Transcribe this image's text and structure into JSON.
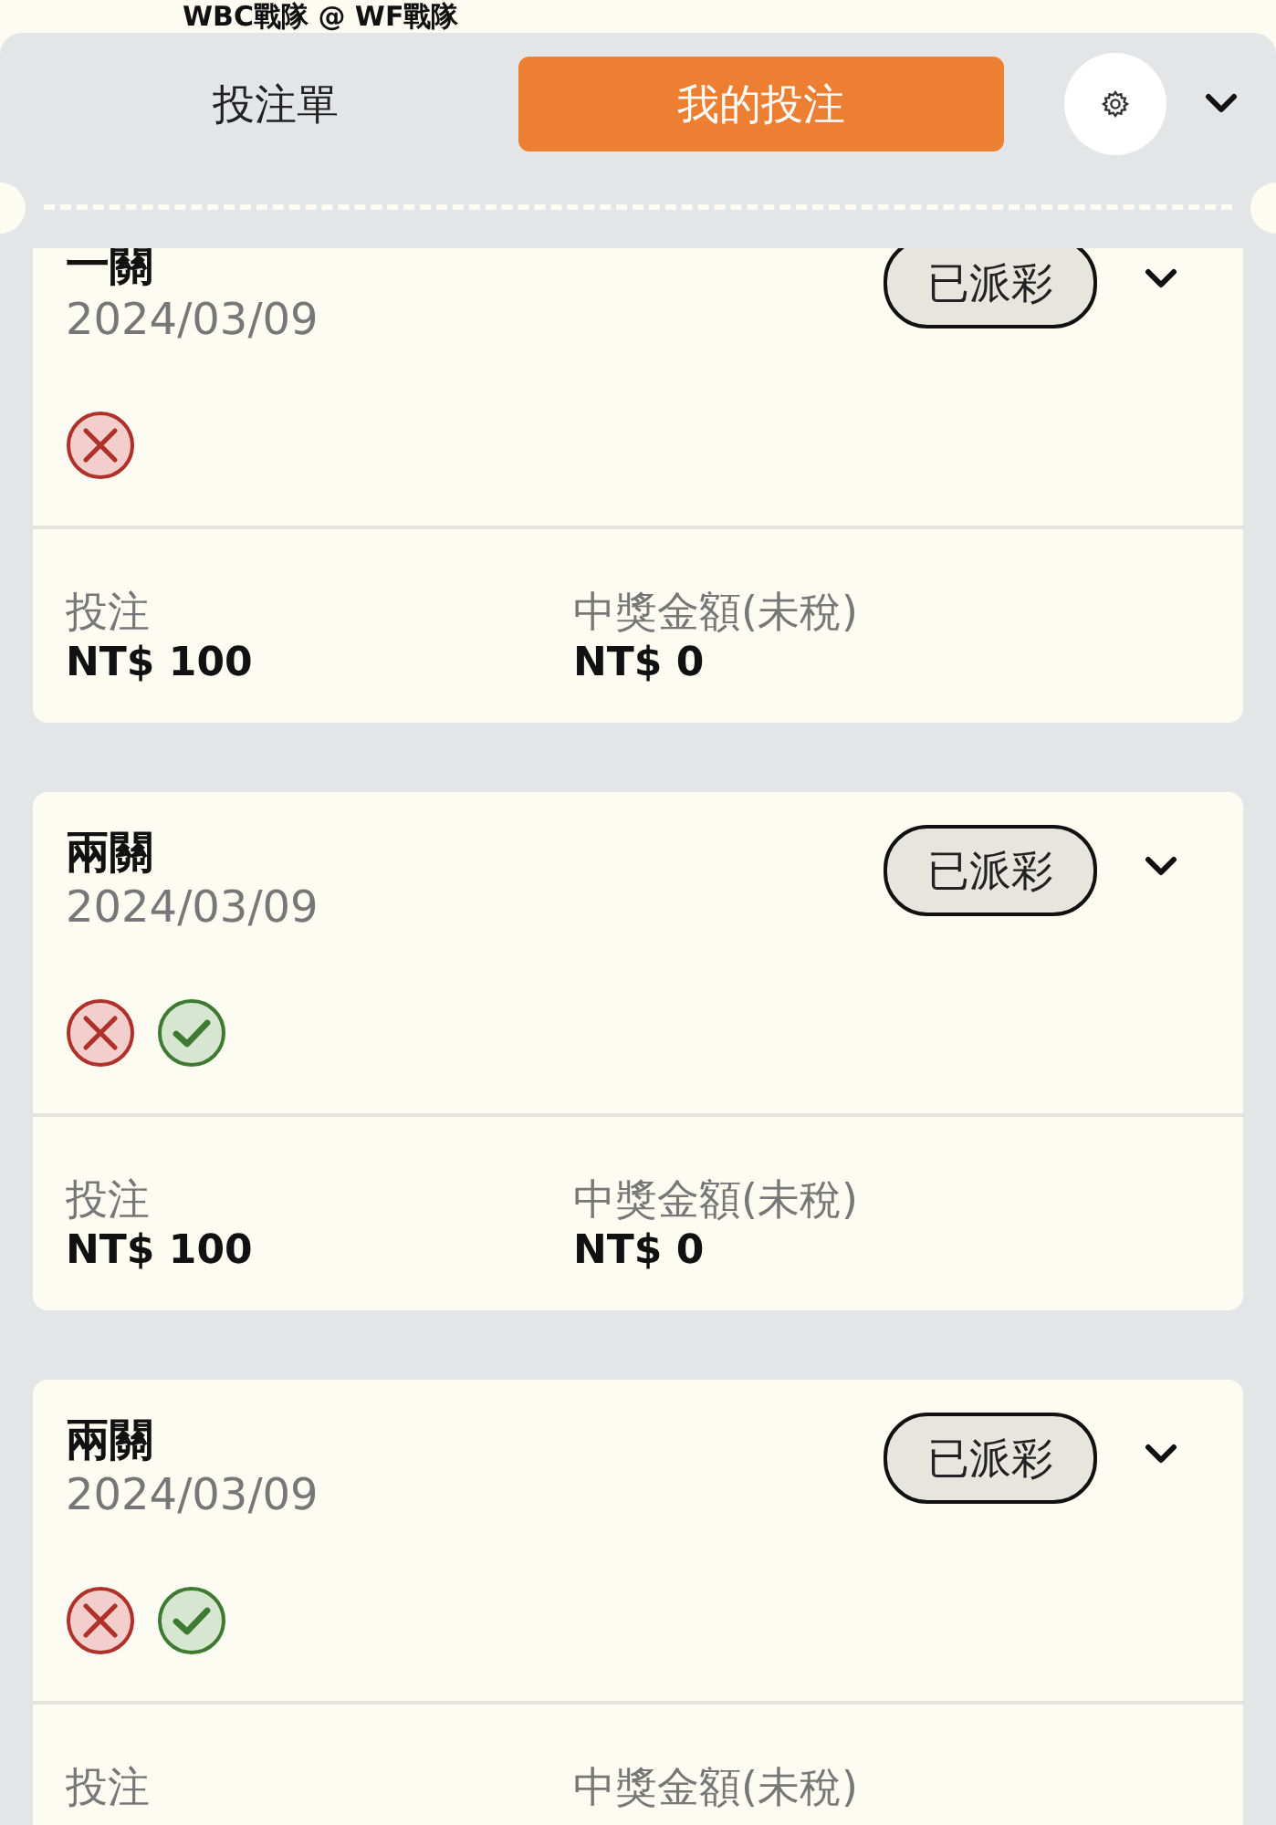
{
  "match_title": "WBC戰隊 @ WF戰隊",
  "tabs": [
    {
      "label": "投注單",
      "selected": false
    },
    {
      "label": "我的投注",
      "selected": true
    }
  ],
  "bets": [
    {
      "title": "一關",
      "date": "2024/03/09",
      "status": "已派彩",
      "results": [
        {
          "kind": "lost"
        }
      ],
      "stake_label": "投注",
      "stake": "NT$ 100",
      "payout_label": "中獎金額(未稅)",
      "payout": "NT$ 0"
    },
    {
      "title": "兩關",
      "date": "2024/03/09",
      "status": "已派彩",
      "results": [
        {
          "kind": "lost"
        },
        {
          "kind": "won"
        }
      ],
      "stake_label": "投注",
      "stake": "NT$ 100",
      "payout_label": "中獎金額(未稅)",
      "payout": "NT$ 0"
    },
    {
      "title": "兩關",
      "date": "2024/03/09",
      "status": "已派彩",
      "results": [
        {
          "kind": "lost"
        },
        {
          "kind": "won"
        }
      ],
      "stake_label": "投注",
      "payout_label": "中獎金額(未稅)"
    }
  ]
}
